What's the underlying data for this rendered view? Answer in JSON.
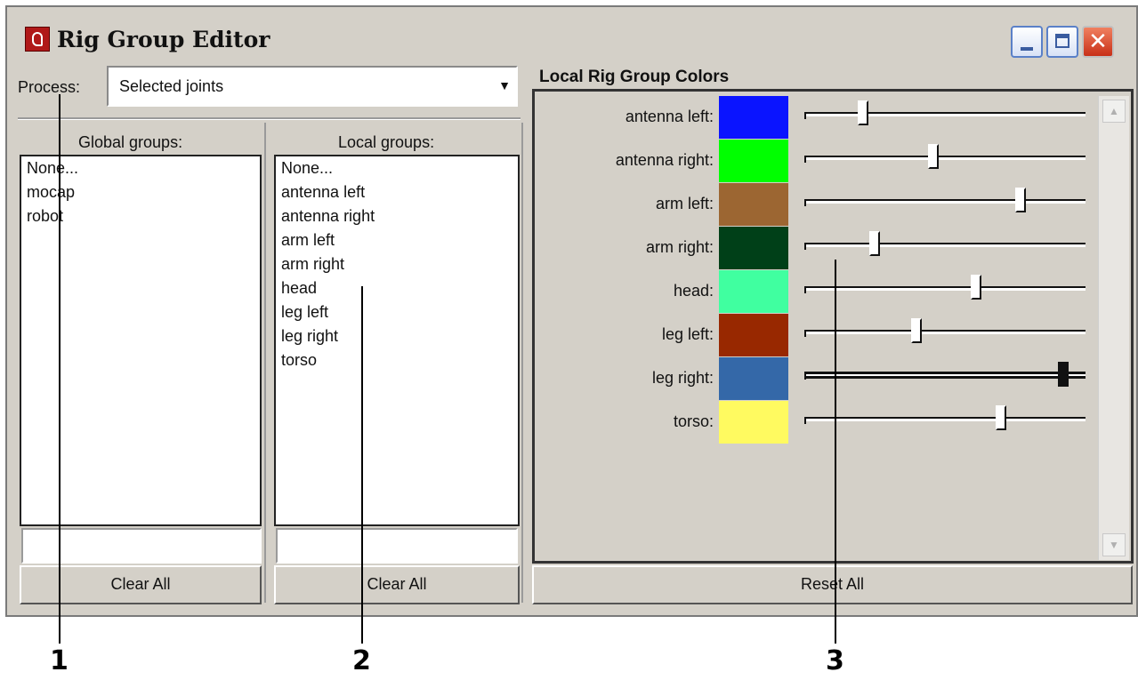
{
  "window": {
    "title": "Rig Group Editor"
  },
  "process": {
    "label": "Process:",
    "value": "Selected joints"
  },
  "global_groups": {
    "header": "Global groups:",
    "items": [
      "None...",
      "mocap",
      "robot"
    ],
    "filter_value": "",
    "clear_label": "Clear All"
  },
  "local_groups": {
    "header": "Local groups:",
    "items": [
      "None...",
      "antenna left",
      "antenna right",
      "arm left",
      "arm right",
      "head",
      "leg left",
      "leg right",
      "torso"
    ],
    "filter_value": "",
    "clear_label": "Clear All"
  },
  "local_colors": {
    "title": "Local Rig Group Colors",
    "reset_label": "Reset All",
    "rows": [
      {
        "label": "antenna left:",
        "color": "#0a14ff",
        "slider": 0.21
      },
      {
        "label": "antenna right:",
        "color": "#00ff00",
        "slider": 0.46
      },
      {
        "label": "arm left:",
        "color": "#9c6632",
        "slider": 0.77
      },
      {
        "label": "arm right:",
        "color": "#004018",
        "slider": 0.25
      },
      {
        "label": "head:",
        "color": "#40ffa0",
        "slider": 0.61
      },
      {
        "label": "leg left:",
        "color": "#982800",
        "slider": 0.4
      },
      {
        "label": "leg right:",
        "color": "#3468a8",
        "slider": 0.92,
        "active": true
      },
      {
        "label": "torso:",
        "color": "#fffa60",
        "slider": 0.7
      }
    ]
  },
  "callouts": [
    "1",
    "2",
    "3"
  ]
}
